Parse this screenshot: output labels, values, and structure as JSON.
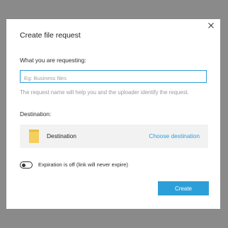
{
  "dialog": {
    "title": "Create file request",
    "close_icon": "close-icon",
    "requesting_label": "What you are requesting:",
    "request_name_placeholder": "Eg: Business files",
    "request_name_value": "",
    "helper_text": "The request name will help you and the uploader identify the request.",
    "destination_label": "Destination:",
    "destination": {
      "icon": "folder-icon",
      "name": "Destination",
      "choose_link": "Choose destination"
    },
    "expiration": {
      "enabled": false,
      "label": "Expiration is off (link will never expire)"
    },
    "create_label": "Create"
  },
  "colors": {
    "overlay": "#8a8a8a",
    "accent": "#2d9fd8",
    "folder": "#f5cf5b"
  }
}
